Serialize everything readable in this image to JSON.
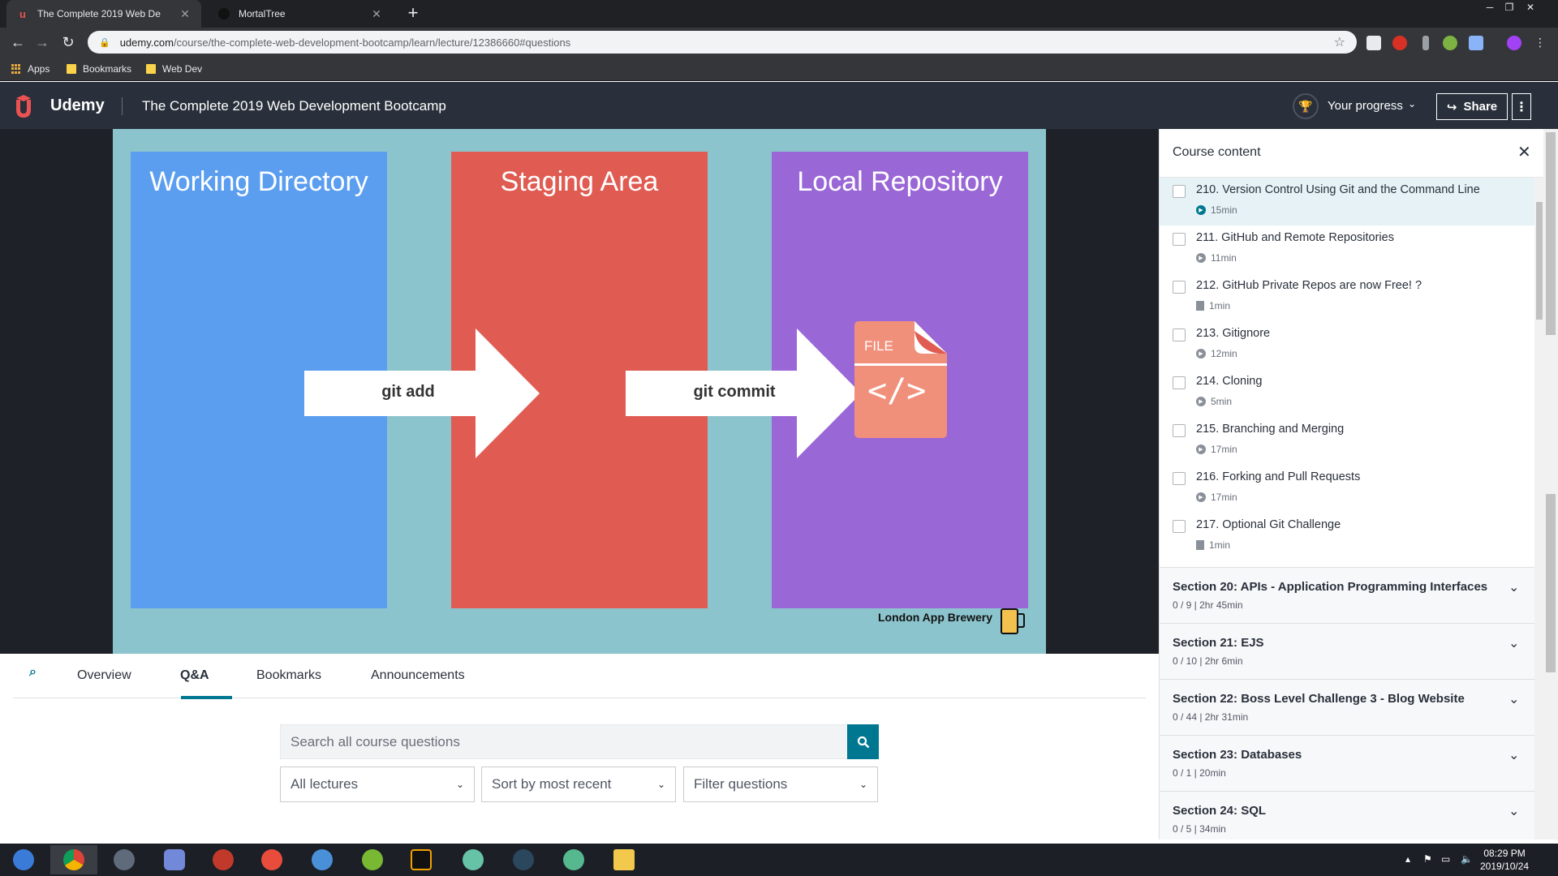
{
  "browser": {
    "tabs": [
      {
        "title": "The Complete 2019 Web De",
        "active": true
      },
      {
        "title": "MortalTree",
        "active": false
      }
    ],
    "url_domain": "udemy.com",
    "url_path": "/course/the-complete-web-development-bootcamp/learn/lecture/12386660#questions",
    "bookmarks": [
      "Apps",
      "Bookmarks",
      "Web Dev"
    ]
  },
  "header": {
    "logo": "Udemy",
    "course_title": "The Complete 2019 Web Development Bootcamp",
    "progress_label": "Your progress",
    "share_label": "Share"
  },
  "slide": {
    "panels": [
      {
        "title": "Working Directory",
        "color": "#5b9ef0"
      },
      {
        "title": "Staging Area",
        "color": "#e05c53"
      },
      {
        "title": "Local Repository",
        "color": "#9a67d7"
      }
    ],
    "arrows": [
      "git add",
      "git commit"
    ],
    "file_label": "FILE",
    "file_code": "</>",
    "brand": "London App Brewery"
  },
  "lecture_tabs": [
    "Overview",
    "Q&A",
    "Bookmarks",
    "Announcements"
  ],
  "active_tab": "Q&A",
  "qa": {
    "search_placeholder": "Search all course questions",
    "filters": [
      "All lectures",
      "Sort by most recent",
      "Filter questions"
    ]
  },
  "sidebar": {
    "title": "Course content",
    "lectures": [
      {
        "title": "210. Version Control Using Git and the Command Line",
        "duration": "15min",
        "type": "video",
        "current": true
      },
      {
        "title": "211. GitHub and Remote Repositories",
        "duration": "11min",
        "type": "video",
        "current": false
      },
      {
        "title": "212. GitHub Private Repos are now Free! ?",
        "duration": "1min",
        "type": "article",
        "current": false
      },
      {
        "title": "213. Gitignore",
        "duration": "12min",
        "type": "video",
        "current": false
      },
      {
        "title": "214. Cloning",
        "duration": "5min",
        "type": "video",
        "current": false
      },
      {
        "title": "215. Branching and Merging",
        "duration": "17min",
        "type": "video",
        "current": false
      },
      {
        "title": "216. Forking and Pull Requests",
        "duration": "17min",
        "type": "video",
        "current": false
      },
      {
        "title": "217. Optional Git Challenge",
        "duration": "1min",
        "type": "article",
        "current": false
      }
    ],
    "sections": [
      {
        "title": "Section 20: APIs - Application Programming Interfaces",
        "meta": "0 / 9 | 2hr 45min"
      },
      {
        "title": "Section 21: EJS",
        "meta": "0 / 10 | 2hr 6min"
      },
      {
        "title": "Section 22: Boss Level Challenge 3 - Blog Website",
        "meta": "0 / 44 | 2hr 31min"
      },
      {
        "title": "Section 23: Databases",
        "meta": "0 / 1 | 20min"
      },
      {
        "title": "Section 24: SQL",
        "meta": "0 / 5 | 34min"
      }
    ]
  },
  "taskbar": {
    "time": "08:29 PM",
    "date": "2019/10/24"
  },
  "colors": {
    "accent": "#007791",
    "udemy_red": "#ec5252",
    "header_bg": "#29303b"
  }
}
